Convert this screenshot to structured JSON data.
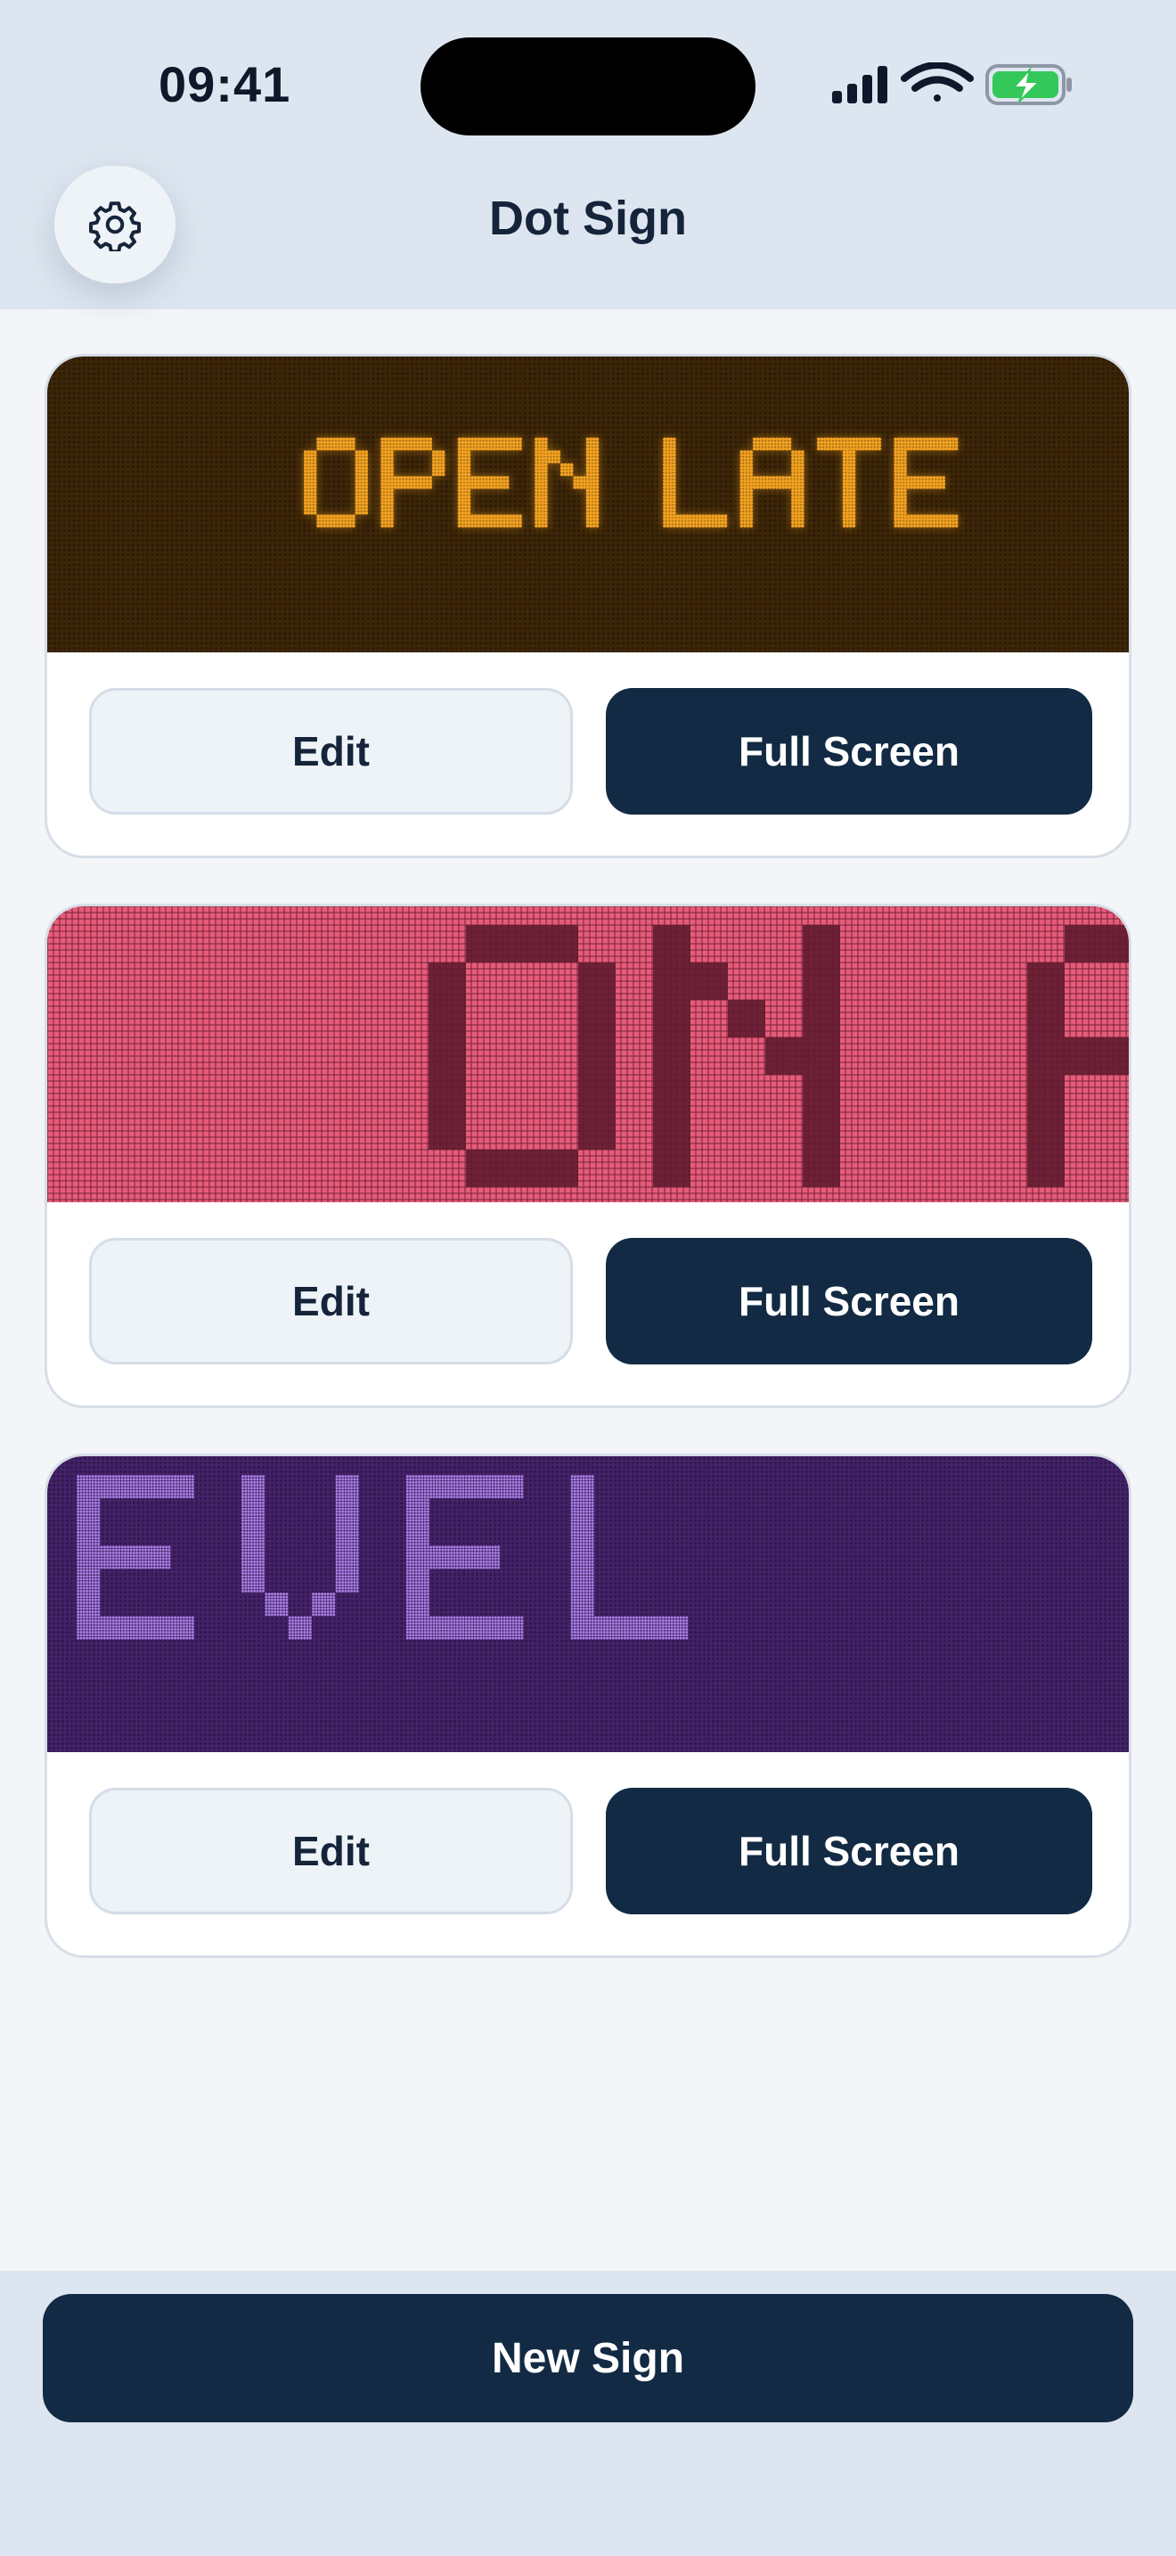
{
  "status_bar": {
    "time": "09:41",
    "icons": [
      "cellular-signal-icon",
      "wifi-icon",
      "battery-charging-icon"
    ],
    "battery_color": "#34c759"
  },
  "header": {
    "title": "Dot Sign",
    "settings_icon": "gear-icon"
  },
  "signs": [
    {
      "text": "OPEN LATE",
      "background": "#3d2608",
      "dot_color": "#f0a020",
      "edit_label": "Edit",
      "fullscreen_label": "Full Screen"
    },
    {
      "text": "ON A",
      "background": "#e65c7a",
      "dot_color": "#6e2136",
      "edit_label": "Edit",
      "fullscreen_label": "Full Screen"
    },
    {
      "text": "EVEL",
      "background": "#44226a",
      "dot_color": "#a77de0",
      "edit_label": "Edit",
      "fullscreen_label": "Full Screen"
    }
  ],
  "footer": {
    "new_sign_label": "New Sign"
  },
  "colors": {
    "primary": "#122a43",
    "surface": "#ffffff",
    "chrome": "#dde6f0"
  }
}
